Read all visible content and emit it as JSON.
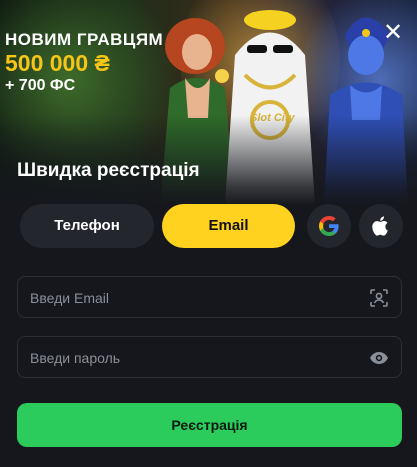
{
  "promo": {
    "title": "НОВИМ ГРАВЦЯМ",
    "amount": "500 000 ₴",
    "spins": "+ 700 ФС",
    "badge": "Slot City"
  },
  "close_icon": "✕",
  "registration": {
    "title": "Швидка реєстрація",
    "methods": {
      "phone": "Телефон",
      "email": "Email"
    },
    "social": [
      "google-icon",
      "apple-icon"
    ],
    "email_field": {
      "placeholder": "Введи Email"
    },
    "password_field": {
      "placeholder": "Введи пароль"
    },
    "submit_label": "Реєстрація"
  },
  "colors": {
    "accent_yellow": "#ffd21f",
    "amount_yellow": "#f5c518",
    "submit_green": "#2bcb5c",
    "background": "#15171c",
    "button_dark": "#23262d"
  }
}
